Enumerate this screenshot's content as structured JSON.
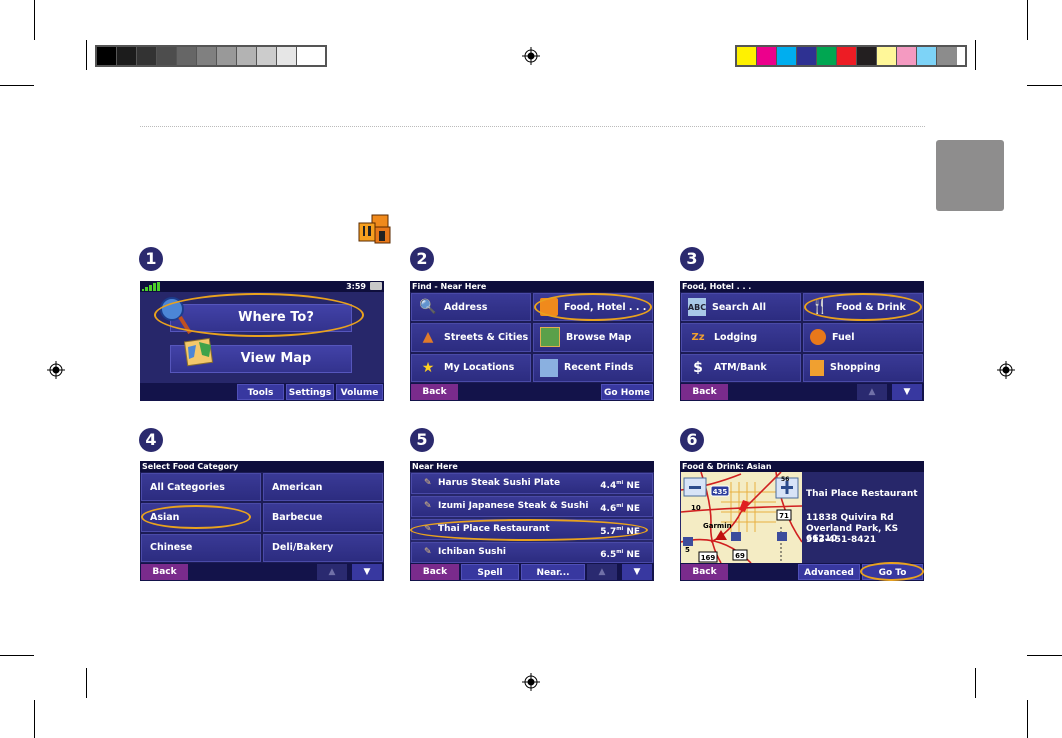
{
  "print_marks": {
    "grayscale_swatches": [
      "#000000",
      "#1c1c1c",
      "#333333",
      "#4d4d4d",
      "#666666",
      "#808080",
      "#999999",
      "#b3b3b3",
      "#cccccc",
      "#e6e6e6",
      "#ffffff"
    ],
    "color_swatches": [
      "#fff100",
      "#ec008c",
      "#00aeef",
      "#2e3192",
      "#00a651",
      "#ed1c24",
      "#231f20",
      "#fff799",
      "#f49ac1",
      "#7dd3f7",
      "#8c8c8c"
    ]
  },
  "steps": [
    {
      "number": "1",
      "status_time": "3:59",
      "buttons": [
        "Where To?",
        "View Map"
      ],
      "bottom_buttons": [
        "Tools",
        "Settings",
        "Volume"
      ]
    },
    {
      "number": "2",
      "title": "Find - Near Here",
      "items": [
        "Address",
        "Food, Hotel . . .",
        "Streets & Cities",
        "Browse Map",
        "My Locations",
        "Recent Finds"
      ],
      "back": "Back",
      "go_home": "Go Home"
    },
    {
      "number": "3",
      "title": "Food, Hotel . . .",
      "items": [
        "Search All",
        "Food & Drink",
        "Lodging",
        "Fuel",
        "ATM/Bank",
        "Shopping"
      ],
      "back": "Back"
    },
    {
      "number": "4",
      "title": "Select Food Category",
      "items": [
        "All Categories",
        "American",
        "Asian",
        "Barbecue",
        "Chinese",
        "Deli/Bakery"
      ],
      "back": "Back"
    },
    {
      "number": "5",
      "title": "Near Here",
      "results": [
        {
          "name": "Harus Steak Sushi Plate",
          "distance": "4.4",
          "unit": "mi",
          "direction": "NE"
        },
        {
          "name": "Izumi Japanese Steak & Sushi",
          "distance": "4.6",
          "unit": "mi",
          "direction": "NE"
        },
        {
          "name": "Thai Place Restaurant",
          "distance": "5.7",
          "unit": "mi",
          "direction": "NE"
        },
        {
          "name": "Ichiban Sushi",
          "distance": "6.5",
          "unit": "mi",
          "direction": "NE"
        }
      ],
      "back": "Back",
      "spell": "Spell",
      "near": "Near..."
    },
    {
      "number": "6",
      "title": "Food & Drink: Asian",
      "place_name": "Thai Place Restaurant",
      "address_line1": "11838 Quivira Rd",
      "address_line2": "Overland Park, KS 66210",
      "phone": "913-451-8421",
      "map_labels": {
        "city": "Garmin",
        "hw_435": "435",
        "hw_69": "69",
        "hw_169": "169",
        "hw_71": "71",
        "hw_56": "56",
        "hw_10": "10",
        "scale": "5"
      },
      "back": "Back",
      "advanced": "Advanced",
      "go_to": "Go To"
    }
  ]
}
